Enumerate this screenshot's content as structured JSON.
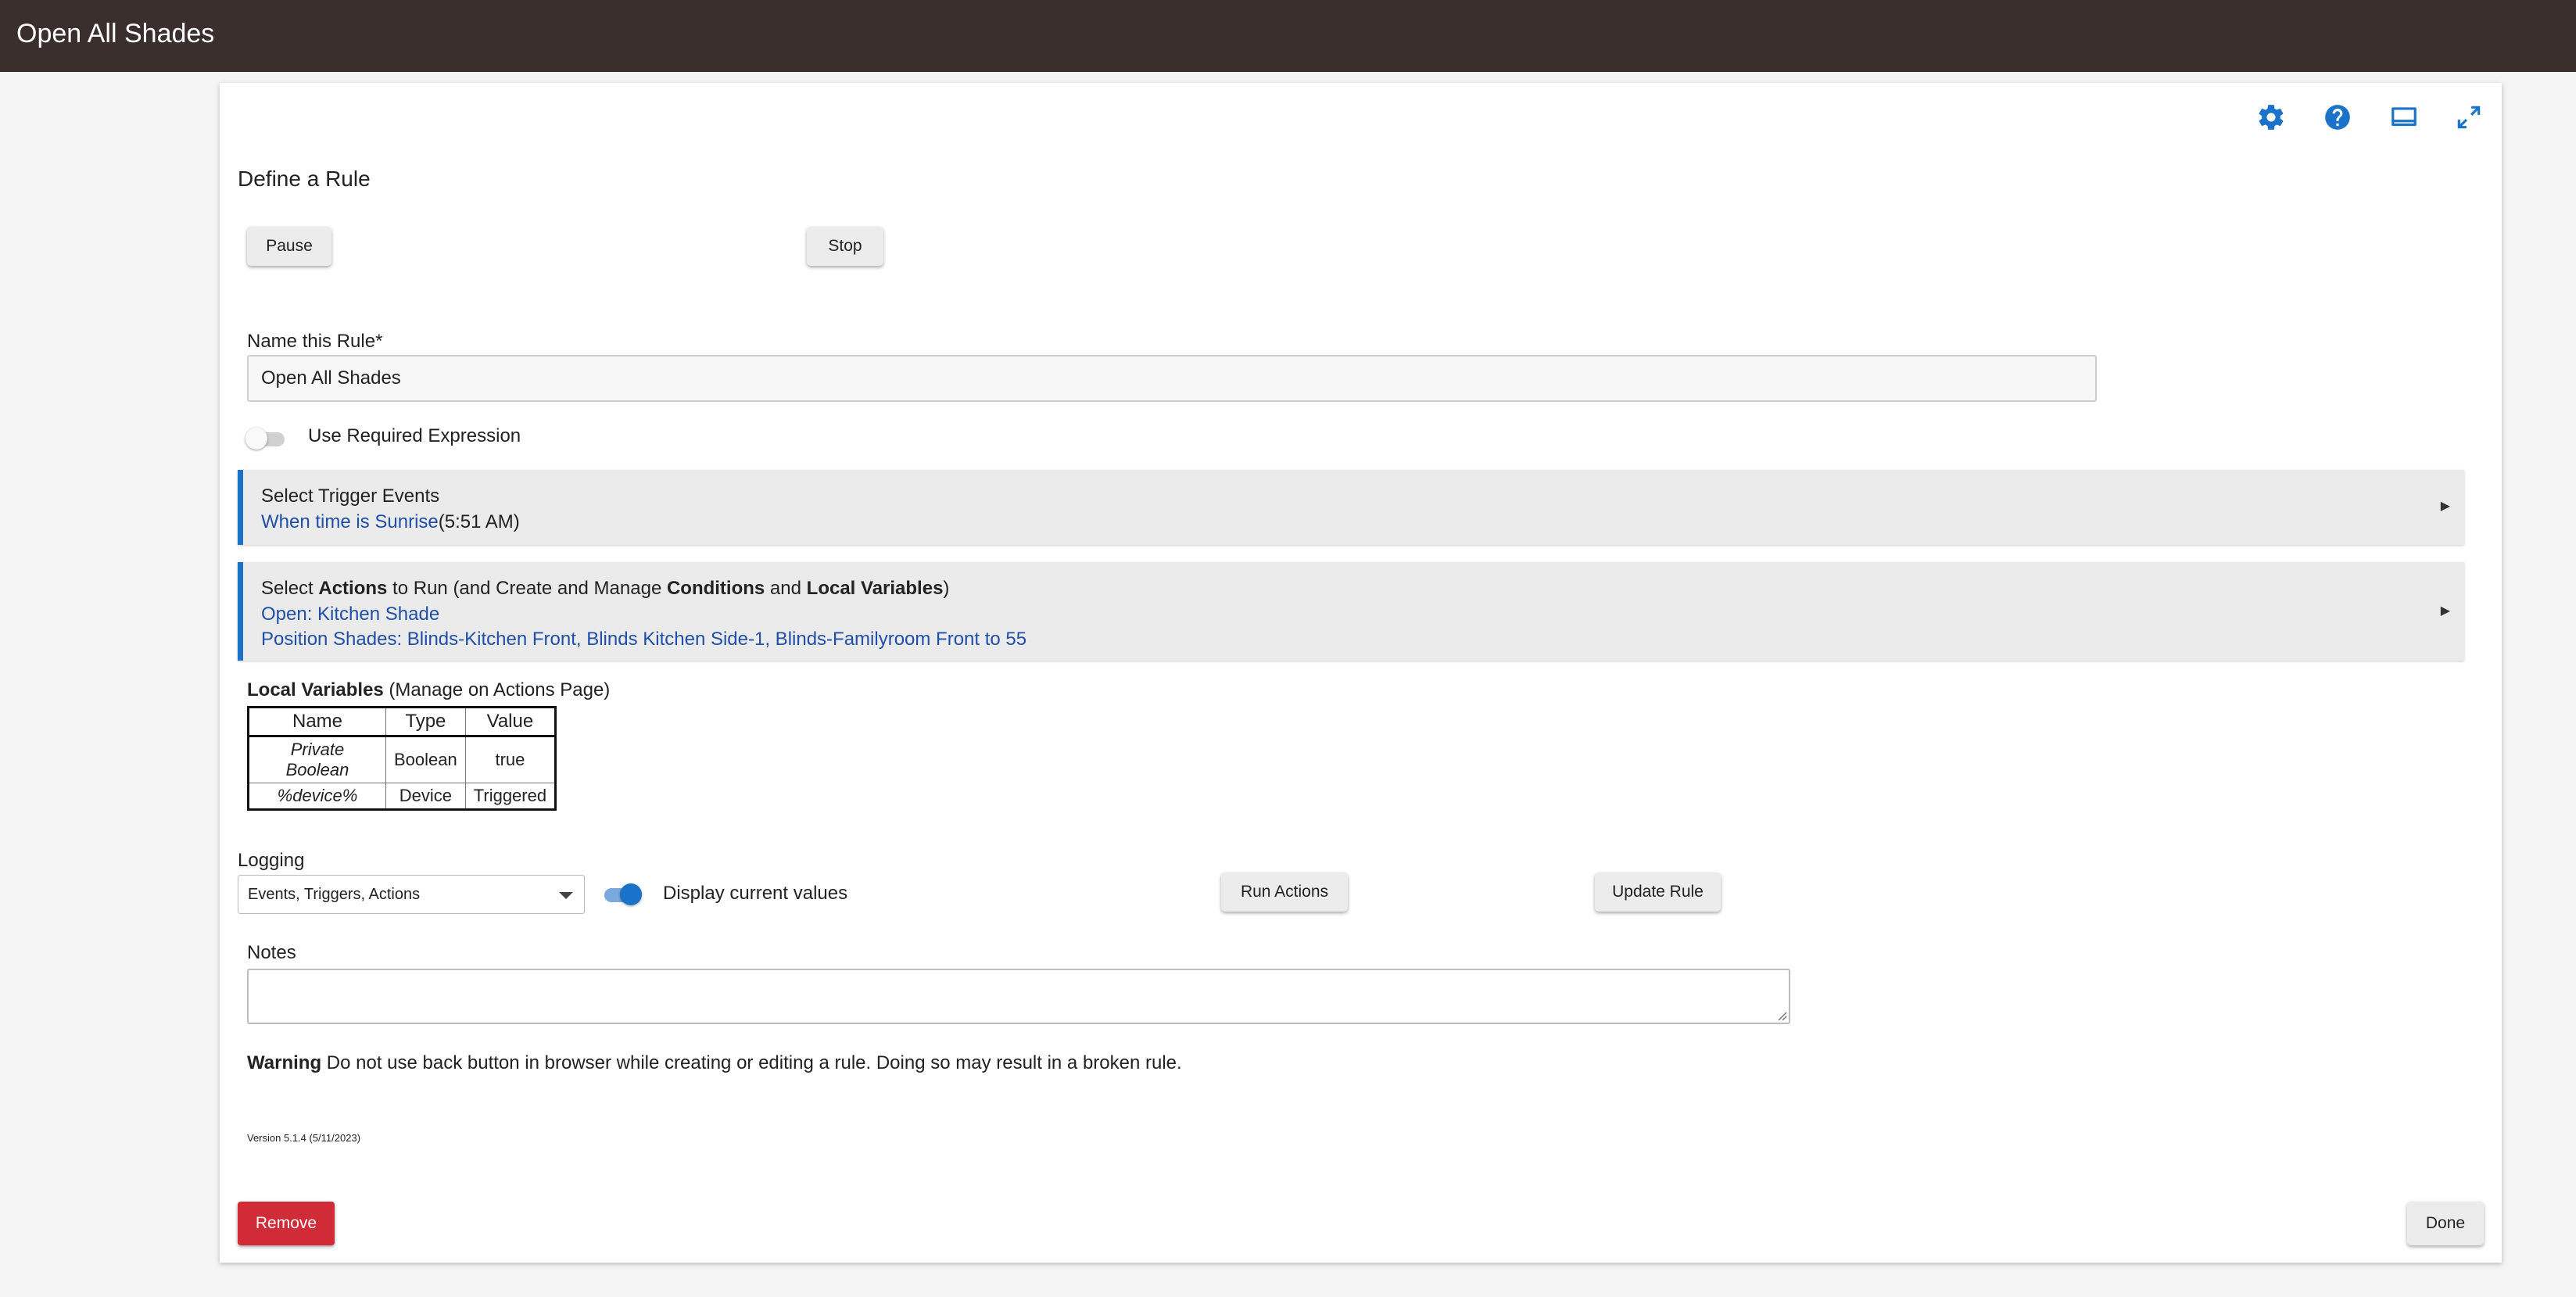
{
  "header": {
    "title": "Open All Shades"
  },
  "toolbar_icons": [
    "gear-icon",
    "help-icon",
    "monitor-icon",
    "fullscreen-icon"
  ],
  "page": {
    "section_title": "Define a Rule",
    "pause_label": "Pause",
    "stop_label": "Stop",
    "name_label": "Name this Rule*",
    "name_value": "Open All Shades",
    "required_expression_label": "Use Required Expression",
    "required_expression_on": false
  },
  "triggers": {
    "title": "Select Trigger Events",
    "event_link": "When time is Sunrise",
    "event_time": "(5:51 AM)"
  },
  "actions": {
    "title_parts": [
      "Select ",
      "Actions",
      " to Run (and Create and Manage ",
      "Conditions",
      " and ",
      "Local Variables",
      ")"
    ],
    "items": [
      "Open: Kitchen Shade",
      "Position Shades: Blinds-Kitchen Front, Blinds Kitchen Side-1, Blinds-Familyroom Front to 55"
    ]
  },
  "local_variables": {
    "title_bold": "Local Variables",
    "title_rest": " (Manage on Actions Page)",
    "columns": [
      "Name",
      "Type",
      "Value"
    ],
    "rows": [
      [
        "Private Boolean",
        "Boolean",
        "true"
      ],
      [
        "%device%",
        "Device",
        "Triggered"
      ]
    ]
  },
  "logging": {
    "label": "Logging",
    "selected": "Events, Triggers, Actions",
    "display_current_values_label": "Display current values",
    "display_current_values_on": true
  },
  "buttons": {
    "run_actions": "Run Actions",
    "update_rule": "Update Rule",
    "remove": "Remove",
    "done": "Done"
  },
  "notes": {
    "label": "Notes",
    "value": ""
  },
  "warning": {
    "bold": "Warning",
    "text": " Do not use back button in browser while creating or editing a rule. Doing so may result in a broken rule."
  },
  "version": "Version 5.1.4 (5/11/2023)",
  "colors": {
    "topbar": "#3a2f2c",
    "accent": "#1a73c9",
    "link": "#1f4fa8",
    "danger": "#d12b37"
  }
}
